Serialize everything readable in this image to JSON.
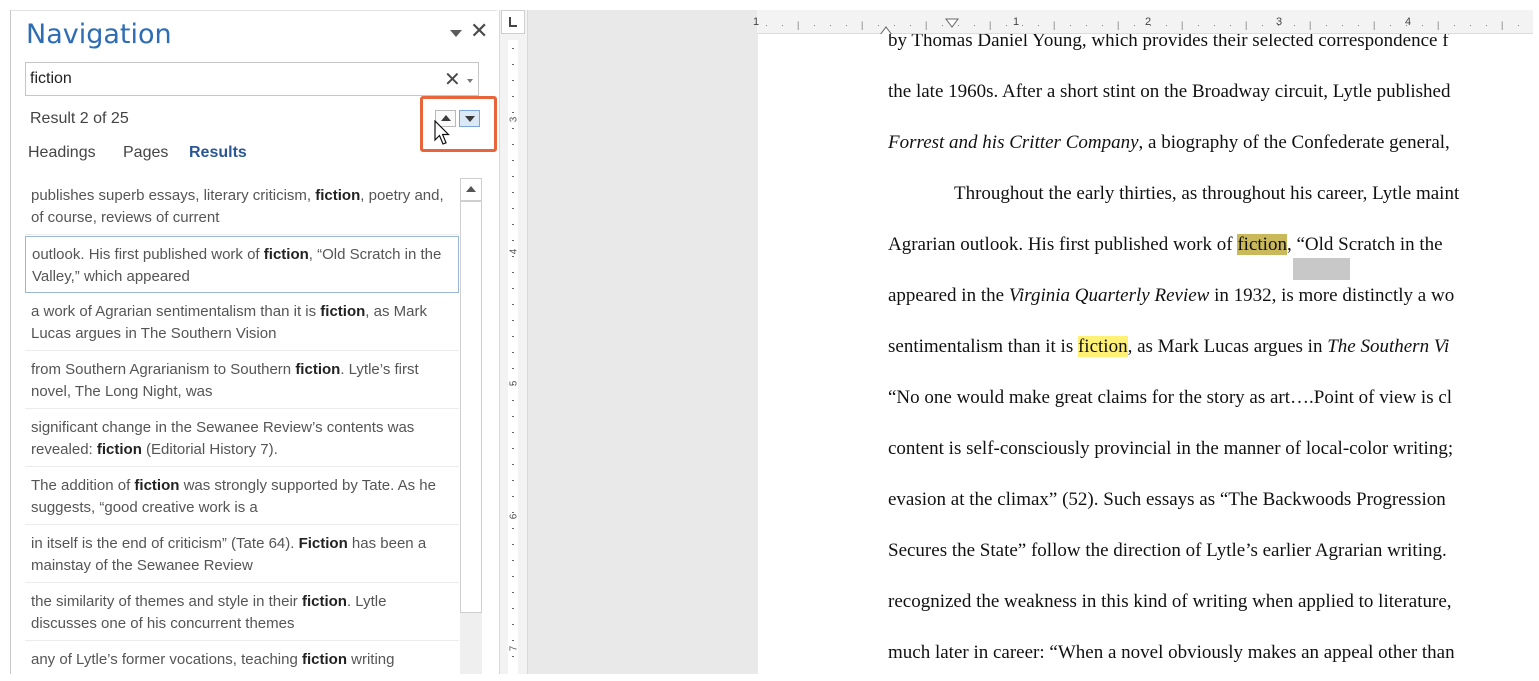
{
  "navigation": {
    "title": "Navigation",
    "search_value": "fiction",
    "result_count": "Result 2 of 25",
    "tabs": [
      {
        "label": "Headings"
      },
      {
        "label": "Pages"
      },
      {
        "label": "Results"
      }
    ],
    "active_tab": "Results",
    "results": [
      {
        "before": "publishes superb essays, literary criticism, ",
        "term": "fiction",
        "after": ", poetry and, of course, reviews of current"
      },
      {
        "before": "outlook.  His first published work of ",
        "term": "fiction",
        "after": ", “Old Scratch in the Valley,” which appeared"
      },
      {
        "before": "a work of Agrarian sentimentalism than it is ",
        "term": "fiction",
        "after": ", as Mark Lucas argues in The Southern Vision"
      },
      {
        "before": "from Southern Agrarianism to Southern ",
        "term": "fiction",
        "after": ". Lytle’s first novel, The Long Night, was"
      },
      {
        "before": "significant change in the Sewanee Review’s contents was revealed: ",
        "term": "fiction",
        "after": " (Editorial History 7)."
      },
      {
        "before": "The addition of ",
        "term": "fiction",
        "after": " was strongly supported by Tate. As he suggests, “good creative work is a"
      },
      {
        "before": "in itself is the end of criticism” (Tate 64). ",
        "term": "Fiction",
        "after": " has been a mainstay of the Sewanee Review"
      },
      {
        "before": "the similarity of themes and style in their ",
        "term": "fiction",
        "after": ". Lytle discusses one of his concurrent themes"
      },
      {
        "before": "any of Lytle’s former vocations, teaching ",
        "term": "fiction",
        "after": " writing"
      }
    ],
    "selected_result_index": 1
  },
  "ruler": {
    "horizontal_numbers": [
      "1",
      "1",
      "2",
      "3",
      "4"
    ],
    "vertical_numbers": [
      "3",
      "4",
      "5",
      "6",
      "7"
    ]
  },
  "document": {
    "lines": [
      {
        "parts": [
          {
            "t": "by Thomas Daniel Young, which provides their selected correspondence f"
          }
        ]
      },
      {
        "parts": [
          {
            "t": "the late 1960s. After a short stint on the Broadway circuit, Lytle published"
          }
        ]
      },
      {
        "parts": [
          {
            "t": "Forrest and his Critter Company",
            "style": "i"
          },
          {
            "t": ", a biography of the Confederate general,"
          }
        ]
      },
      {
        "parts": [
          {
            "t": "Throughout the early thirties, as throughout his career, Lytle maint"
          }
        ],
        "indent": true
      },
      {
        "parts": [
          {
            "t": "Agrarian outlook.  His first published work of "
          },
          {
            "t": "fiction",
            "style": "hit-current"
          },
          {
            "t": ", “Old Scratch in the"
          }
        ]
      },
      {
        "parts": [
          {
            "t": "appeared in the "
          },
          {
            "t": "Virginia Quarterly Review",
            "style": "i"
          },
          {
            "t": " in 1932, is more distinctly a wo"
          }
        ]
      },
      {
        "parts": [
          {
            "t": "sentimentalism than it is "
          },
          {
            "t": "fiction",
            "style": "hit"
          },
          {
            "t": ", as Mark Lucas argues in "
          },
          {
            "t": "The Southern Vi",
            "style": "i"
          }
        ]
      },
      {
        "parts": [
          {
            "t": "“No one would make great claims for the story as art….Point of view is cl"
          }
        ]
      },
      {
        "parts": [
          {
            "t": "content is self-consciously provincial in the manner of local-color writing;"
          }
        ]
      },
      {
        "parts": [
          {
            "t": "evasion at the climax” (52).  Such essays as “The Backwoods Progression"
          }
        ]
      },
      {
        "parts": [
          {
            "t": "Secures the State” follow the direction of Lytle’s earlier Agrarian writing."
          }
        ]
      },
      {
        "parts": [
          {
            "t": "recognized the weakness in this kind of writing when applied to literature,"
          }
        ]
      },
      {
        "parts": [
          {
            "t": "much later in career: “When a novel obviously makes an appeal other than"
          }
        ]
      }
    ]
  },
  "colors": {
    "nav_title": "#2e6cb5",
    "active_tab": "#2b5797",
    "callout_frame": "#e8643b",
    "current_hit": "#c9b95b",
    "other_hit": "#fff176"
  },
  "icons": [
    "pane-options-icon",
    "close-icon",
    "clear-search-icon",
    "search-options-icon",
    "previous-result-icon",
    "next-result-icon",
    "mouse-pointer-icon",
    "scroll-up-icon",
    "tab-stop-selector-icon",
    "indent-marker-icon"
  ]
}
